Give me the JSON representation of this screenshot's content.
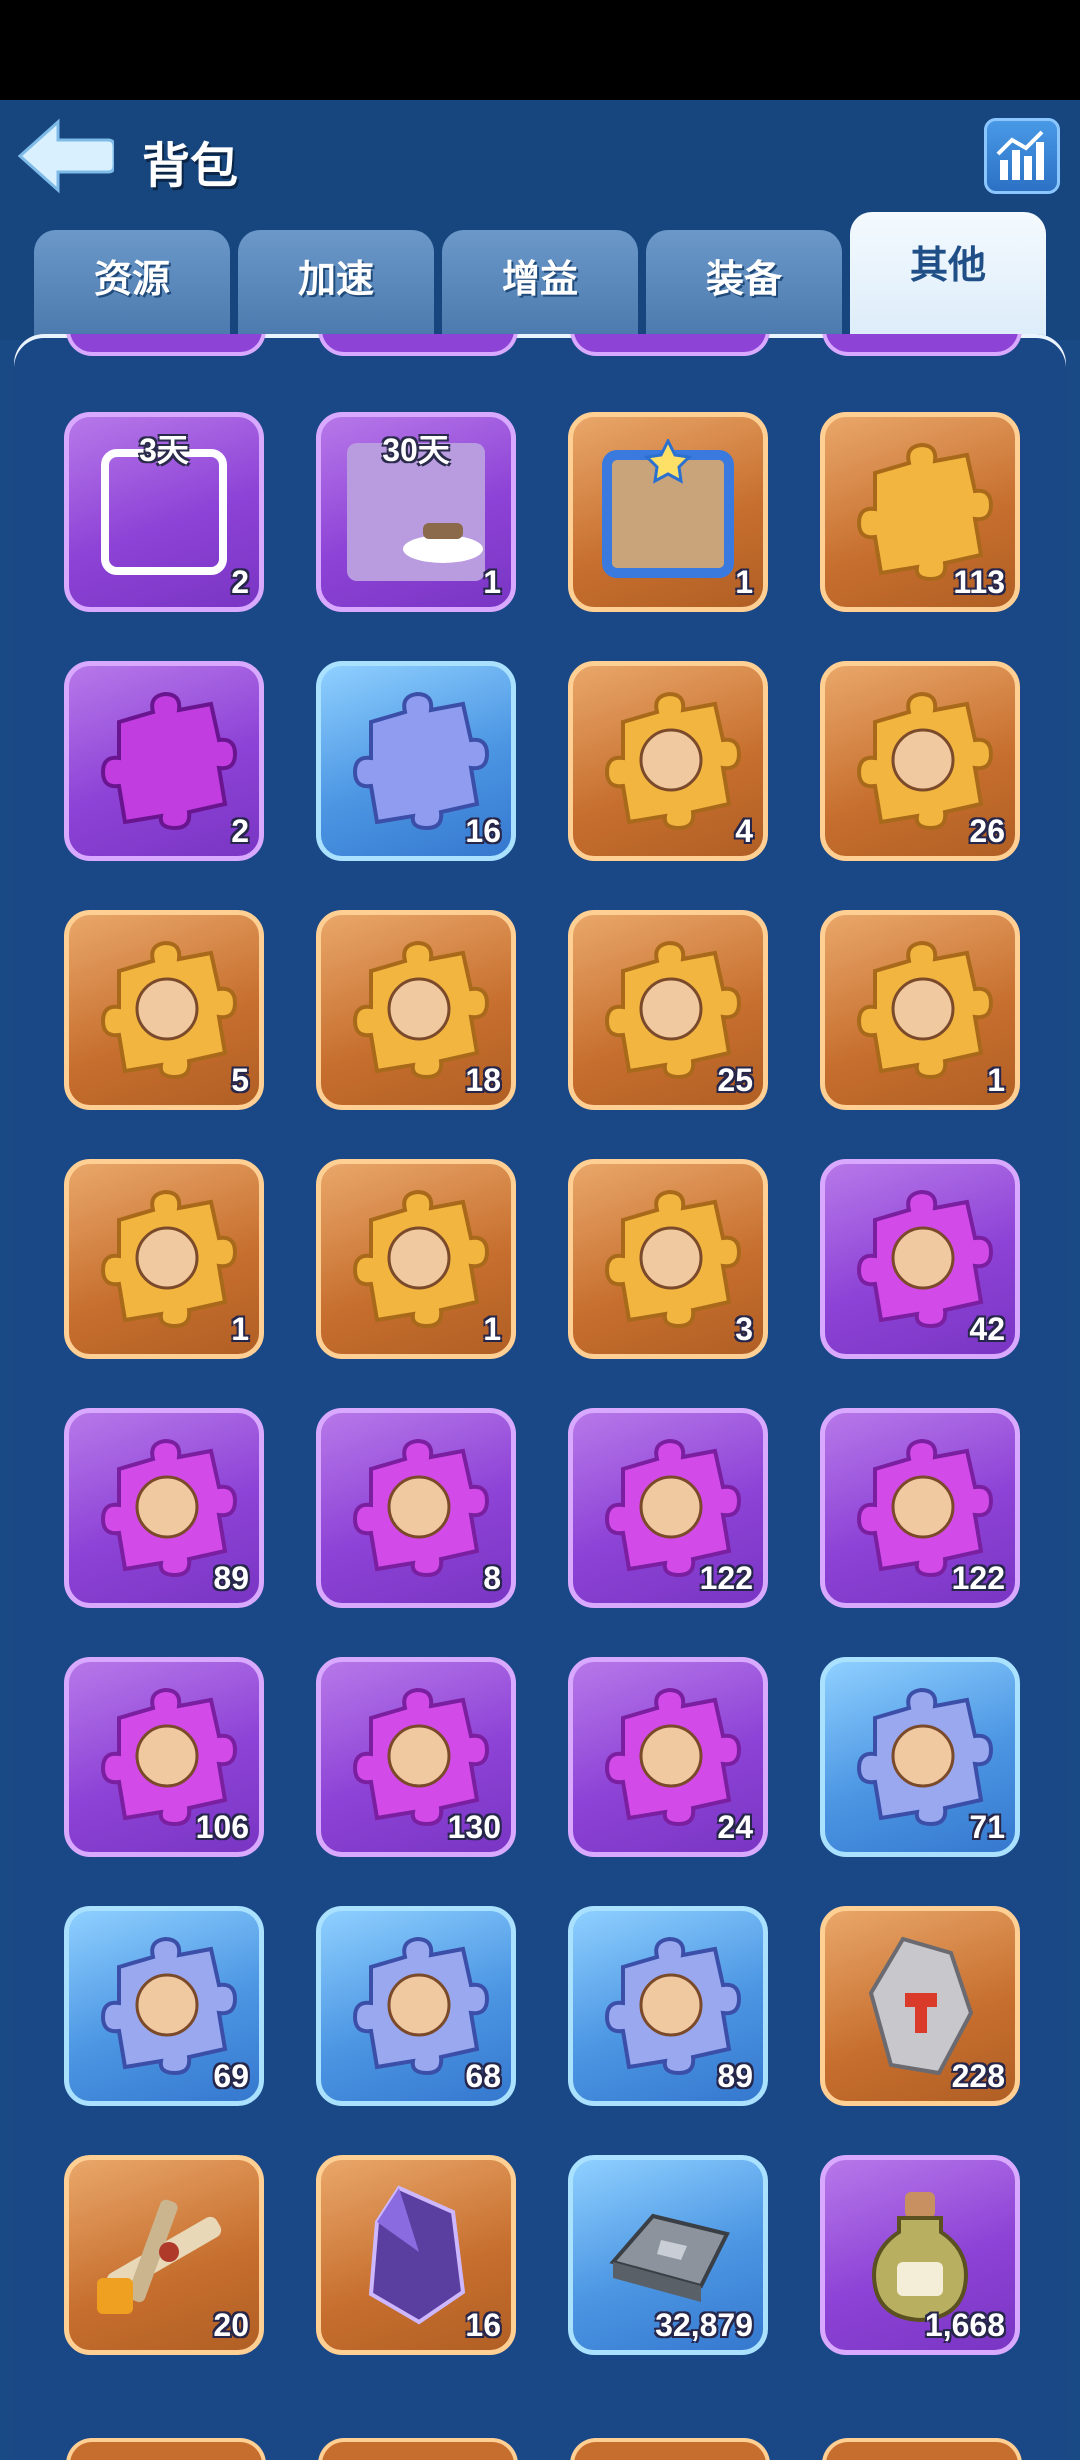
{
  "header": {
    "title": "背包"
  },
  "tabs": [
    {
      "label": "资源",
      "active": false
    },
    {
      "label": "加速",
      "active": false
    },
    {
      "label": "增益",
      "active": false
    },
    {
      "label": "装备",
      "active": false
    },
    {
      "label": "其他",
      "active": true
    }
  ],
  "items": [
    {
      "icon": "avatar-frame-icon",
      "rarity": "purple",
      "days": "3天",
      "qty": "2"
    },
    {
      "icon": "airship-background-icon",
      "rarity": "purple",
      "days": "30天",
      "qty": "1"
    },
    {
      "icon": "star-frame-icon",
      "rarity": "orange",
      "days": "",
      "qty": "1"
    },
    {
      "icon": "gold-puzzle-piece-icon",
      "rarity": "orange",
      "days": "",
      "qty": "113"
    },
    {
      "icon": "purple-puzzle-piece-icon",
      "rarity": "purple",
      "days": "",
      "qty": "2"
    },
    {
      "icon": "blue-puzzle-piece-icon",
      "rarity": "blue",
      "days": "",
      "qty": "16"
    },
    {
      "icon": "hero-fragment-hooded-icon",
      "rarity": "orange",
      "days": "",
      "qty": "4"
    },
    {
      "icon": "hero-fragment-old-warrior-icon",
      "rarity": "orange",
      "days": "",
      "qty": "26"
    },
    {
      "icon": "hero-fragment-blond-warrior-icon",
      "rarity": "orange",
      "days": "",
      "qty": "5"
    },
    {
      "icon": "hero-fragment-earmuff-girl-icon",
      "rarity": "orange",
      "days": "",
      "qty": "18"
    },
    {
      "icon": "hero-fragment-top-hat-icon",
      "rarity": "orange",
      "days": "",
      "qty": "25"
    },
    {
      "icon": "hero-fragment-bearded-elder-icon",
      "rarity": "orange",
      "days": "",
      "qty": "1"
    },
    {
      "icon": "hero-fragment-plague-mask-icon",
      "rarity": "orange",
      "days": "",
      "qty": "1"
    },
    {
      "icon": "hero-fragment-miner-icon",
      "rarity": "orange",
      "days": "",
      "qty": "1"
    },
    {
      "icon": "hero-fragment-white-hair-girl-icon",
      "rarity": "orange",
      "days": "",
      "qty": "3"
    },
    {
      "icon": "hero-fragment-goggles-man-icon",
      "rarity": "purple",
      "days": "",
      "qty": "42"
    },
    {
      "icon": "hero-fragment-dark-hair-girl-icon",
      "rarity": "purple",
      "days": "",
      "qty": "89"
    },
    {
      "icon": "hero-fragment-red-hair-girl-icon",
      "rarity": "purple",
      "days": "",
      "qty": "8"
    },
    {
      "icon": "hero-fragment-pilot-elder-icon",
      "rarity": "purple",
      "days": "",
      "qty": "122"
    },
    {
      "icon": "hero-fragment-aviator-icon",
      "rarity": "purple",
      "days": "",
      "qty": "122"
    },
    {
      "icon": "hero-fragment-santa-dwarf-icon",
      "rarity": "purple",
      "days": "",
      "qty": "106"
    },
    {
      "icon": "hero-fragment-helmet-dwarf-icon",
      "rarity": "purple",
      "days": "",
      "qty": "130"
    },
    {
      "icon": "hero-fragment-pink-hair-girl-icon",
      "rarity": "purple",
      "days": "",
      "qty": "24"
    },
    {
      "icon": "hero-fragment-blond-boy-icon",
      "rarity": "blue",
      "days": "",
      "qty": "71"
    },
    {
      "icon": "hero-fragment-mustache-captain-icon",
      "rarity": "blue",
      "days": "",
      "qty": "69"
    },
    {
      "icon": "hero-fragment-goggles-dwarf-icon",
      "rarity": "blue",
      "days": "",
      "qty": "68"
    },
    {
      "icon": "hero-fragment-green-cap-dwarf-icon",
      "rarity": "blue",
      "days": "",
      "qty": "89"
    },
    {
      "icon": "hammer-stone-icon",
      "rarity": "orange",
      "days": "",
      "qty": "228"
    },
    {
      "icon": "airplane-blueprint-icon",
      "rarity": "orange",
      "days": "",
      "qty": "20"
    },
    {
      "icon": "purple-crystal-icon",
      "rarity": "orange",
      "days": "",
      "qty": "16"
    },
    {
      "icon": "iron-ingot-icon",
      "rarity": "blue",
      "days": "",
      "qty": "32,879"
    },
    {
      "icon": "potion-bottle-icon",
      "rarity": "purple",
      "days": "",
      "qty": "1,668"
    }
  ]
}
